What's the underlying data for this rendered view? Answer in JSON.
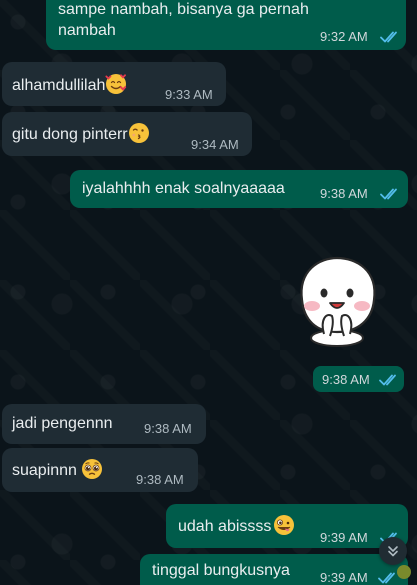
{
  "messages": [
    {
      "id": "m1",
      "side": "out",
      "lines": [
        "sampe nambah, bisanya ga pernah",
        "nambah"
      ],
      "time": "9:32 AM",
      "status": "read"
    },
    {
      "id": "m2",
      "side": "in",
      "text": "alhamdullilah",
      "emoji": "smiling-face-with-hearts-emoji",
      "time": "9:33 AM"
    },
    {
      "id": "m3",
      "side": "in",
      "text": "gitu dong pinterr",
      "emoji": "kissing-face-emoji",
      "time": "9:34 AM"
    },
    {
      "id": "m4",
      "side": "out",
      "text": "iyalahhhh enak soalnyaaaaa",
      "time": "9:38 AM",
      "status": "read"
    },
    {
      "id": "m5",
      "side": "out",
      "sticker": "sticker-blob-character",
      "time": "9:38 AM",
      "status": "read"
    },
    {
      "id": "m6",
      "side": "in",
      "text": "jadi pengennn",
      "time": "9:38 AM"
    },
    {
      "id": "m7",
      "side": "in",
      "text": "suapinnn",
      "emoji": "pleading-face-emoji",
      "time": "9:38 AM"
    },
    {
      "id": "m8",
      "side": "out",
      "text": "udah abissss",
      "emoji": "zany-face-emoji",
      "time": "9:39 AM",
      "status": "read"
    },
    {
      "id": "m9",
      "side": "out",
      "text": "tinggal bungkusnya",
      "time": "9:39 AM",
      "status": "read"
    }
  ],
  "ui": {
    "scroll_button_icon": "double-chevron-down-icon"
  },
  "colors": {
    "background": "#0b141a",
    "incoming_bubble": "#1f2c34",
    "outgoing_bubble": "#005c4b",
    "read_ticks": "#53bdeb"
  }
}
